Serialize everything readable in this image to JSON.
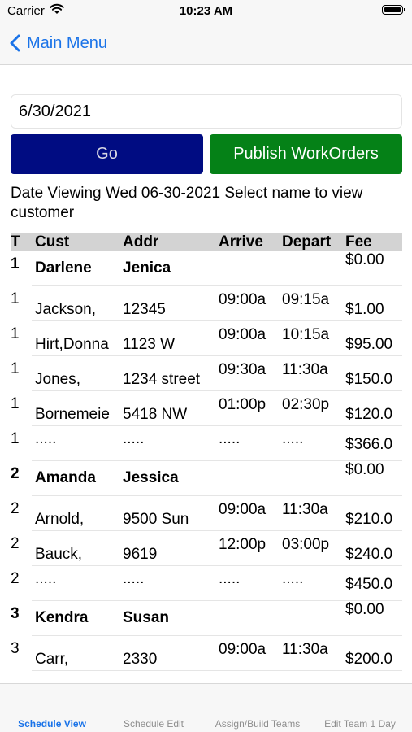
{
  "status": {
    "carrier": "Carrier",
    "time": "10:23 AM"
  },
  "nav": {
    "back_label": "Main Menu"
  },
  "date_field": {
    "value": "6/30/2021"
  },
  "buttons": {
    "go": "Go",
    "publish": "Publish WorkOrders"
  },
  "info_text": "Date Viewing Wed 06-30-2021   Select name to view customer",
  "table": {
    "headers": {
      "t": "T",
      "cust": "Cust",
      "addr": "Addr",
      "arrive": "Arrive",
      "depart": "Depart",
      "fee": "Fee"
    },
    "rows": [
      {
        "type": "team",
        "t": "1",
        "cust": "Darlene",
        "addr": "Jenica",
        "arrive": "",
        "depart": "",
        "fee": "$0.00"
      },
      {
        "type": "job",
        "t": "1",
        "cust": "Jackson,",
        "addr": "12345",
        "arrive": "09:00a",
        "depart": "09:15a",
        "fee": "$1.00"
      },
      {
        "type": "job",
        "t": "1",
        "cust": "Hirt,Donna",
        "addr": "1123 W",
        "arrive": "09:00a",
        "depart": "10:15a",
        "fee": "$95.00"
      },
      {
        "type": "job",
        "t": "1",
        "cust": "Jones,",
        "addr": "1234 street",
        "arrive": "09:30a",
        "depart": "11:30a",
        "fee": "$150.0"
      },
      {
        "type": "job",
        "t": "1",
        "cust": "Bornemeie",
        "addr": "5418 NW",
        "arrive": "01:00p",
        "depart": "02:30p",
        "fee": "$120.0"
      },
      {
        "type": "sum",
        "t": "1",
        "cust": ".....",
        "addr": ".....",
        "arrive": ".....",
        "depart": ".....",
        "fee": "$366.0"
      },
      {
        "type": "team",
        "t": "2",
        "cust": "Amanda",
        "addr": "Jessica",
        "arrive": "",
        "depart": "",
        "fee": "$0.00"
      },
      {
        "type": "job",
        "t": "2",
        "cust": "Arnold,",
        "addr": "9500 Sun",
        "arrive": "09:00a",
        "depart": "11:30a",
        "fee": "$210.0"
      },
      {
        "type": "job",
        "t": "2",
        "cust": "Bauck,",
        "addr": "9619",
        "arrive": "12:00p",
        "depart": "03:00p",
        "fee": "$240.0"
      },
      {
        "type": "sum",
        "t": "2",
        "cust": ".....",
        "addr": ".....",
        "arrive": ".....",
        "depart": ".....",
        "fee": "$450.0"
      },
      {
        "type": "team",
        "t": "3",
        "cust": "Kendra",
        "addr": "Susan",
        "arrive": "",
        "depart": "",
        "fee": "$0.00"
      },
      {
        "type": "job",
        "t": "3",
        "cust": "Carr,",
        "addr": "2330",
        "arrive": "09:00a",
        "depart": "11:30a",
        "fee": "$200.0"
      }
    ]
  },
  "tabs": [
    {
      "label": "Schedule View",
      "active": true
    },
    {
      "label": "Schedule Edit",
      "active": false
    },
    {
      "label": "Assign/Build Teams",
      "active": false
    },
    {
      "label": "Edit Team 1 Day",
      "active": false
    }
  ],
  "colors": {
    "accent": "#1a73e8",
    "go_button": "#000c82",
    "publish_button": "#058117",
    "header_bg": "#d3d3d3"
  },
  "icons": {
    "back": "chevron-left-icon",
    "wifi": "wifi-icon",
    "battery": "battery-icon"
  }
}
